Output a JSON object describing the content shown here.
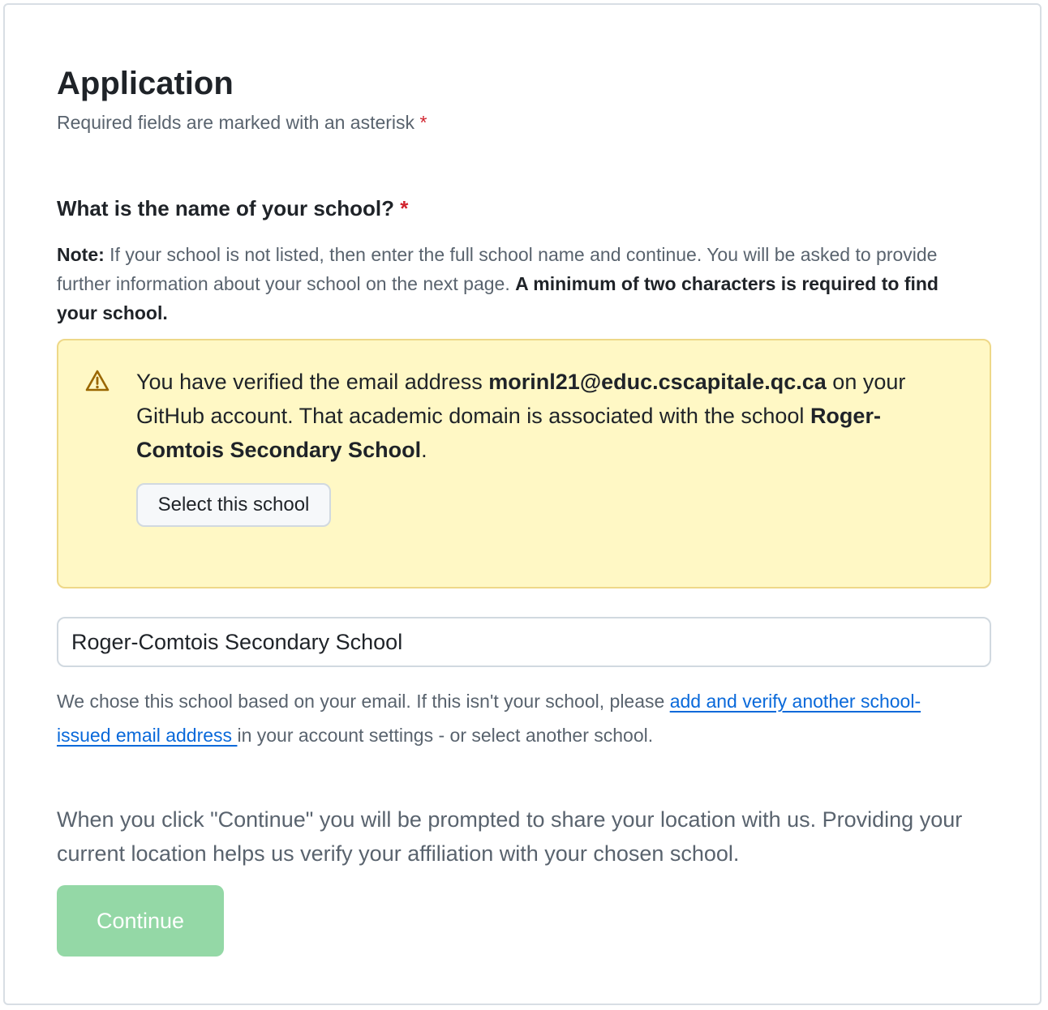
{
  "header": {
    "title": "Application",
    "subtitle": "Required fields are marked with an asterisk",
    "asterisk": "*"
  },
  "question": {
    "label": "What is the name of your school?",
    "asterisk": "*",
    "note_label": "Note:",
    "note_text": " If your school is not listed, then enter the full school name and continue. You will be asked to provide further information about your school on the next page. ",
    "note_bold": "A minimum of two characters is required to find your school."
  },
  "flash": {
    "icon": "alert-triangle-icon",
    "text_1": "You have verified the email address ",
    "email": "morinl21@educ.cscapitale.qc.ca",
    "text_2": " on your GitHub account. That academic domain is associated with the school ",
    "school": "Roger-Comtois Secondary School",
    "text_3": ".",
    "button_label": "Select this school"
  },
  "school_input": {
    "value": "Roger-Comtois Secondary School"
  },
  "hint": {
    "text_1": "We chose this school based on your email. If this isn't your school, please ",
    "link": "add and verify another school-issued email address ",
    "text_2": "in your account settings - or select another school."
  },
  "location_notice": "When you click \"Continue\" you will be prompted to share your location with us. Providing your current location helps us verify your affiliation with your chosen school.",
  "continue_button": {
    "label": "Continue"
  },
  "colors": {
    "required": "#d1242f",
    "link": "#0969da",
    "flash_bg": "#fff8c5",
    "flash_border": "#eed888",
    "warn_icon": "#9a6700",
    "continue_disabled": "#94d8a6"
  }
}
